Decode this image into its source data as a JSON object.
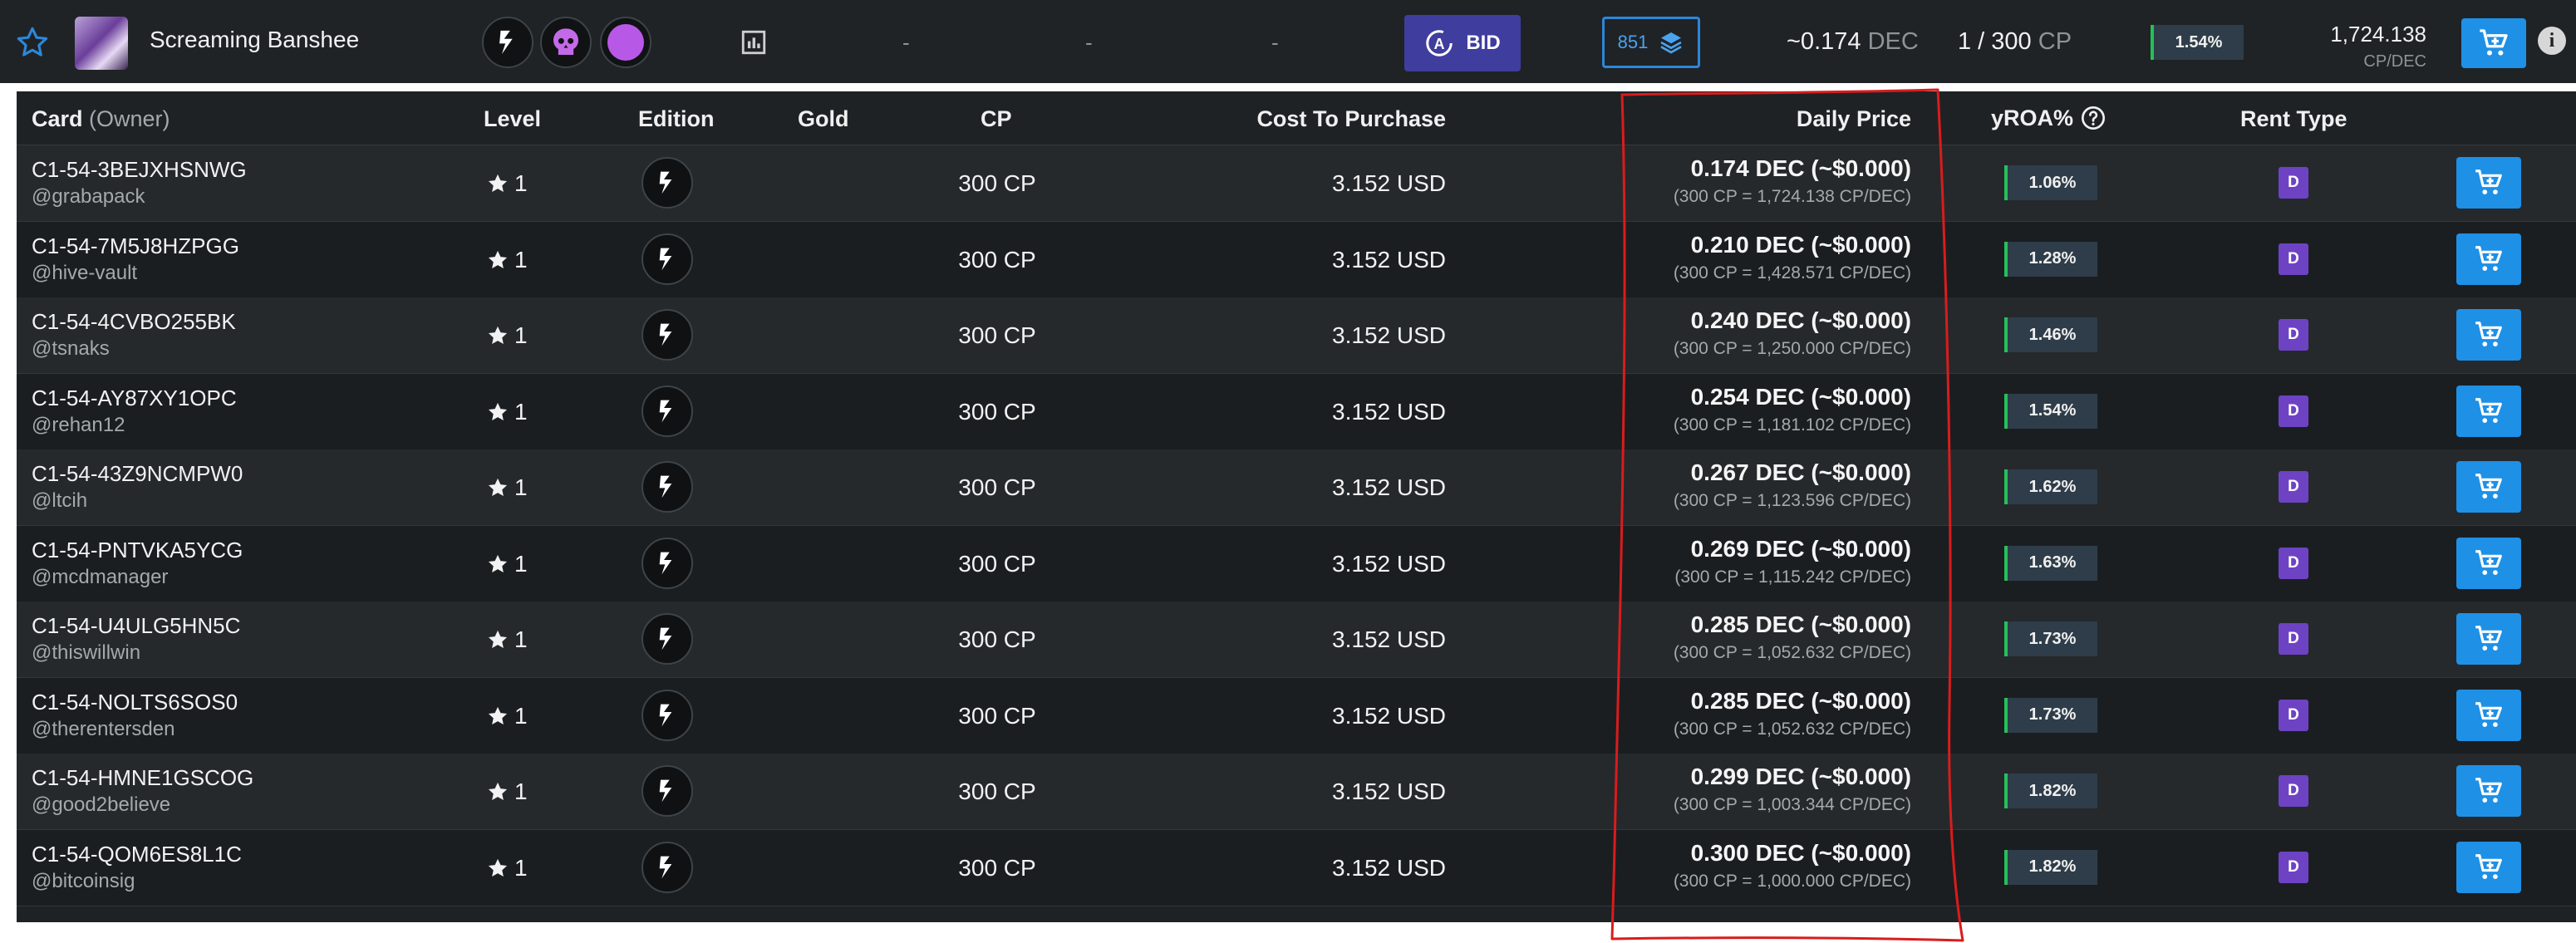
{
  "summary": {
    "card_name": "Screaming Banshee",
    "col_gold": "-",
    "col_cp": "-",
    "col_cost": "-",
    "bid_label": "BID",
    "stack_count": "851",
    "avg_price": "~0.174",
    "avg_price_unit": "DEC",
    "cp_count": "1 / 300",
    "cp_unit": "CP",
    "roa": "1.54%",
    "cp_per_dec": "1,724.138",
    "cp_per_dec_unit": "CP/DEC",
    "info_glyph": "i"
  },
  "table": {
    "headers": {
      "card": "Card",
      "owner": "(Owner)",
      "level": "Level",
      "edition": "Edition",
      "gold": "Gold",
      "cp": "CP",
      "cost": "Cost To Purchase",
      "daily_price": "Daily Price",
      "yroa": "yROA%",
      "rent_type": "Rent Type"
    },
    "rows": [
      {
        "id": "C1-54-3BEJXHSNWG",
        "owner": "@grabapack",
        "level": "1",
        "cp": "300 CP",
        "cost": "3.152 USD",
        "price": "0.174 DEC (~$0.000)",
        "price_sub": "(300 CP = 1,724.138 CP/DEC)",
        "roa": "1.06%",
        "rent": "D"
      },
      {
        "id": "C1-54-7M5J8HZPGG",
        "owner": "@hive-vault",
        "level": "1",
        "cp": "300 CP",
        "cost": "3.152 USD",
        "price": "0.210 DEC (~$0.000)",
        "price_sub": "(300 CP = 1,428.571 CP/DEC)",
        "roa": "1.28%",
        "rent": "D"
      },
      {
        "id": "C1-54-4CVBO255BK",
        "owner": "@tsnaks",
        "level": "1",
        "cp": "300 CP",
        "cost": "3.152 USD",
        "price": "0.240 DEC (~$0.000)",
        "price_sub": "(300 CP = 1,250.000 CP/DEC)",
        "roa": "1.46%",
        "rent": "D"
      },
      {
        "id": "C1-54-AY87XY1OPC",
        "owner": "@rehan12",
        "level": "1",
        "cp": "300 CP",
        "cost": "3.152 USD",
        "price": "0.254 DEC (~$0.000)",
        "price_sub": "(300 CP = 1,181.102 CP/DEC)",
        "roa": "1.54%",
        "rent": "D"
      },
      {
        "id": "C1-54-43Z9NCMPW0",
        "owner": "@ltcih",
        "level": "1",
        "cp": "300 CP",
        "cost": "3.152 USD",
        "price": "0.267 DEC (~$0.000)",
        "price_sub": "(300 CP = 1,123.596 CP/DEC)",
        "roa": "1.62%",
        "rent": "D"
      },
      {
        "id": "C1-54-PNTVKA5YCG",
        "owner": "@mcdmanager",
        "level": "1",
        "cp": "300 CP",
        "cost": "3.152 USD",
        "price": "0.269 DEC (~$0.000)",
        "price_sub": "(300 CP = 1,115.242 CP/DEC)",
        "roa": "1.63%",
        "rent": "D"
      },
      {
        "id": "C1-54-U4ULG5HN5C",
        "owner": "@thiswillwin",
        "level": "1",
        "cp": "300 CP",
        "cost": "3.152 USD",
        "price": "0.285 DEC (~$0.000)",
        "price_sub": "(300 CP = 1,052.632 CP/DEC)",
        "roa": "1.73%",
        "rent": "D"
      },
      {
        "id": "C1-54-NOLTS6SOS0",
        "owner": "@therentersden",
        "level": "1",
        "cp": "300 CP",
        "cost": "3.152 USD",
        "price": "0.285 DEC (~$0.000)",
        "price_sub": "(300 CP = 1,052.632 CP/DEC)",
        "roa": "1.73%",
        "rent": "D"
      },
      {
        "id": "C1-54-HMNE1GSCOG",
        "owner": "@good2believe",
        "level": "1",
        "cp": "300 CP",
        "cost": "3.152 USD",
        "price": "0.299 DEC (~$0.000)",
        "price_sub": "(300 CP = 1,003.344 CP/DEC)",
        "roa": "1.82%",
        "rent": "D"
      },
      {
        "id": "C1-54-QOM6ES8L1C",
        "owner": "@bitcoinsig",
        "level": "1",
        "cp": "300 CP",
        "cost": "3.152 USD",
        "price": "0.300 DEC (~$0.000)",
        "price_sub": "(300 CP = 1,000.000 CP/DEC)",
        "roa": "1.82%",
        "rent": "D"
      }
    ]
  },
  "icons": {
    "favorite": "star-outline-icon",
    "edition": "edition-bolt-icon",
    "monster": "skull-icon",
    "element": "death-element-icon",
    "frame": "card-frame-icon",
    "bid": "auto-bid-icon",
    "stack": "layers-icon",
    "cart": "cart-add-icon",
    "info": "info-icon",
    "level": "star-icon",
    "roa_help": "question-circle-icon"
  },
  "colors": {
    "accent": "#1e90e6",
    "bid": "#3f3d9e",
    "rent_badge": "#6d43c4",
    "roa_bar": "#24c157",
    "highlight_ink": "#d91c1c"
  }
}
